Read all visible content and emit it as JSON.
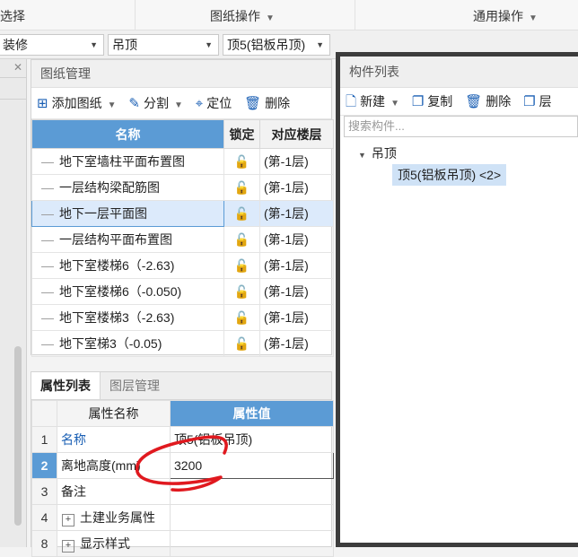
{
  "ribbon": {
    "left_label": "选择",
    "drawing_ops": "图纸操作",
    "general_ops": "通用操作"
  },
  "dropdowns": {
    "category": "装修",
    "type": "吊顶",
    "component": "顶5(铝板吊顶)"
  },
  "drawing_panel": {
    "title": "图纸管理",
    "toolbar": {
      "add": "添加图纸",
      "split": "分割",
      "locate": "定位",
      "delete": "删除"
    },
    "columns": {
      "name": "名称",
      "lock": "锁定",
      "floor": "对应楼层"
    },
    "rows": [
      {
        "name": "地下室墙柱平面布置图",
        "floor": "(第-1层)"
      },
      {
        "name": "一层结构梁配筋图",
        "floor": "(第-1层)"
      },
      {
        "name": "地下一层平面图",
        "floor": "(第-1层)"
      },
      {
        "name": "一层结构平面布置图",
        "floor": "(第-1层)"
      },
      {
        "name": "地下室楼梯6（-2.63)",
        "floor": "(第-1层)"
      },
      {
        "name": "地下室楼梯6（-0.050)",
        "floor": "(第-1层)"
      },
      {
        "name": "地下室楼梯3（-2.63)",
        "floor": "(第-1层)"
      },
      {
        "name": "地下室梯3（-0.05)",
        "floor": "(第-1层)"
      }
    ]
  },
  "property_panel": {
    "tabs": [
      "属性列表",
      "图层管理"
    ],
    "columns": {
      "name": "属性名称",
      "value": "属性值"
    },
    "rows": [
      {
        "num": "1",
        "name": "名称",
        "value": "顶5(铝板吊顶)"
      },
      {
        "num": "2",
        "name": "离地高度(mm)",
        "value": "3200"
      },
      {
        "num": "3",
        "name": "备注",
        "value": ""
      },
      {
        "num": "4",
        "name": "土建业务属性",
        "value": ""
      },
      {
        "num": "8",
        "name": "显示样式",
        "value": ""
      }
    ]
  },
  "component_panel": {
    "title": "构件列表",
    "toolbar": {
      "new": "新建",
      "copy": "复制",
      "delete": "删除",
      "layer": "层"
    },
    "search_placeholder": "搜索构件...",
    "tree": {
      "group": "吊顶",
      "item": "顶5(铝板吊顶) <2>"
    }
  },
  "colors": {
    "accent": "#5b9bd5",
    "annotation": "#e0191f",
    "window_border": "#3c3c3c"
  }
}
